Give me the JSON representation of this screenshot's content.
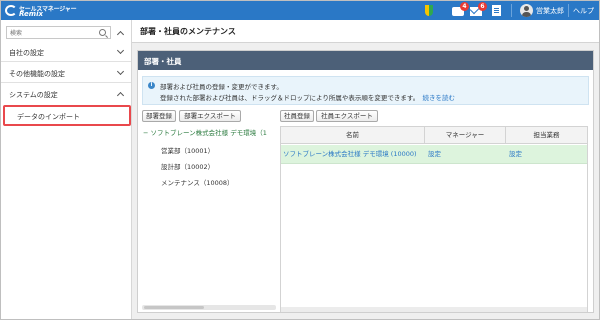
{
  "topbar": {
    "logo_line1": "セールスマネージャー",
    "logo_line2": "Remix",
    "badge_messages": "4",
    "badge_mail": "6",
    "user_name": "営業太郎",
    "help_label": "ヘルプ",
    "colors": {
      "bar": "#2a78c6",
      "badge": "#e83a33"
    }
  },
  "sidebar": {
    "search_placeholder": "検索",
    "items": [
      {
        "label": "自社の設定",
        "state": "collapsed"
      },
      {
        "label": "その他機能の設定",
        "state": "collapsed"
      },
      {
        "label": "システムの設定",
        "state": "expanded"
      }
    ],
    "sub_item": "データのインポート",
    "highlight_color": "#e9484c"
  },
  "main": {
    "header_title": "部署・社員のメンテナンス",
    "panel_title": "部署・社員",
    "info_line1": "部署および社員の登録・変更ができます。",
    "info_line2": "登録された部署および社員は、ドラッグ＆ドロップにより所属や表示順を変更できます。",
    "info_link": "続きを読む",
    "buttons": {
      "dept_register": "部署登録",
      "dept_export": "部署エクスポート",
      "emp_register": "社員登録",
      "emp_export": "社員エクスポート"
    },
    "tree": {
      "root": "− ソフトブレーン株式会社様 デモ環境（1",
      "children": [
        "営業部（10001）",
        "設計部（10002）",
        "メンテナンス（10008）"
      ]
    },
    "grid": {
      "columns": [
        "名前",
        "マネージャー",
        "担当業務"
      ],
      "rows": [
        {
          "name": "ソフトブレーン株式会社様 デモ環境 (10000)",
          "manager": "設定",
          "task": "設定"
        }
      ]
    },
    "panel_header_color": "#4c6078",
    "selected_row_color": "#ddf4dd"
  }
}
